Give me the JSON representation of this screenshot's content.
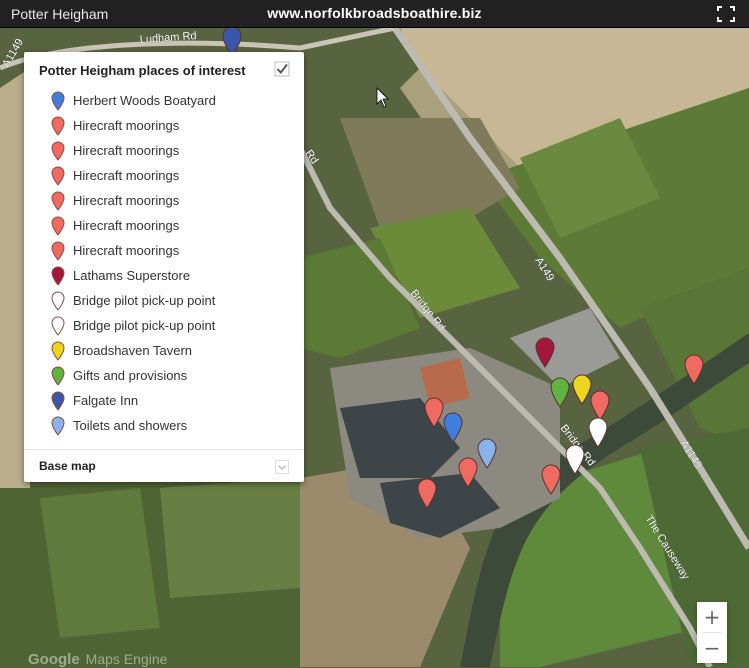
{
  "header": {
    "title": "Potter Heigham",
    "site": "www.norfolkbroadsboathire.biz",
    "fullscreen_icon": "fullscreen-icon"
  },
  "panel": {
    "title": "Potter Heigham places of interest",
    "checked": true,
    "items": [
      {
        "label": "Herbert Woods Boatyard",
        "color": "#3d7ede",
        "icon": "map-pin-icon"
      },
      {
        "label": "Hirecraft moorings",
        "color": "#ef6b61",
        "icon": "map-pin-icon"
      },
      {
        "label": "Hirecraft moorings",
        "color": "#ef6b61",
        "icon": "map-pin-icon"
      },
      {
        "label": "Hirecraft moorings",
        "color": "#ef6b61",
        "icon": "map-pin-icon"
      },
      {
        "label": "Hirecraft moorings",
        "color": "#ef6b61",
        "icon": "map-pin-icon"
      },
      {
        "label": "Hirecraft moorings",
        "color": "#ef6b61",
        "icon": "map-pin-icon"
      },
      {
        "label": "Hirecraft moorings",
        "color": "#ef6b61",
        "icon": "map-pin-icon"
      },
      {
        "label": "Lathams Superstore",
        "color": "#a3173f",
        "icon": "map-pin-icon"
      },
      {
        "label": "Bridge pilot pick-up point",
        "color": "#ffffff",
        "icon": "map-pin-icon"
      },
      {
        "label": "Bridge pilot pick-up point",
        "color": "#ffffff",
        "icon": "map-pin-icon"
      },
      {
        "label": "Broadshaven Tavern",
        "color": "#ecd51f",
        "icon": "map-pin-icon"
      },
      {
        "label": "Gifts and provisions",
        "color": "#5fb43f",
        "icon": "map-pin-icon"
      },
      {
        "label": "Falgate Inn",
        "color": "#3b55a8",
        "icon": "map-pin-icon"
      },
      {
        "label": "Toilets and showers",
        "color": "#89b3ec",
        "icon": "map-pin-icon"
      }
    ],
    "base_map_label": "Base map"
  },
  "map": {
    "road_labels": [
      "Ludham Rd",
      "A149",
      "Bridge Rd",
      "A1149",
      "Bridge Rd",
      "A1149",
      "The Causeway",
      "Rd"
    ],
    "markers": [
      {
        "name": "Falgate Inn",
        "color": "#3b55a8"
      },
      {
        "name": "Lathams Superstore",
        "color": "#a3173f"
      },
      {
        "name": "Gifts and provisions",
        "color": "#5fb43f"
      },
      {
        "name": "Broadshaven Tavern",
        "color": "#ecd51f"
      },
      {
        "name": "Hirecraft moorings",
        "color": "#ef6b61"
      },
      {
        "name": "Bridge pilot pick-up point",
        "color": "#ffffff"
      },
      {
        "name": "Bridge pilot pick-up point",
        "color": "#ffffff"
      },
      {
        "name": "Hirecraft moorings",
        "color": "#ef6b61"
      },
      {
        "name": "Hirecraft moorings",
        "color": "#ef6b61"
      },
      {
        "name": "Herbert Woods Boatyard",
        "color": "#3d7ede"
      },
      {
        "name": "Toilets and showers",
        "color": "#89b3ec"
      },
      {
        "name": "Hirecraft moorings",
        "color": "#ef6b61"
      },
      {
        "name": "Hirecraft moorings",
        "color": "#ef6b61"
      },
      {
        "name": "Hirecraft moorings",
        "color": "#ef6b61"
      }
    ]
  },
  "zoom": {
    "in_label": "+",
    "out_label": "−"
  },
  "attribution": {
    "brand": "Google",
    "text": "Maps Engine"
  }
}
